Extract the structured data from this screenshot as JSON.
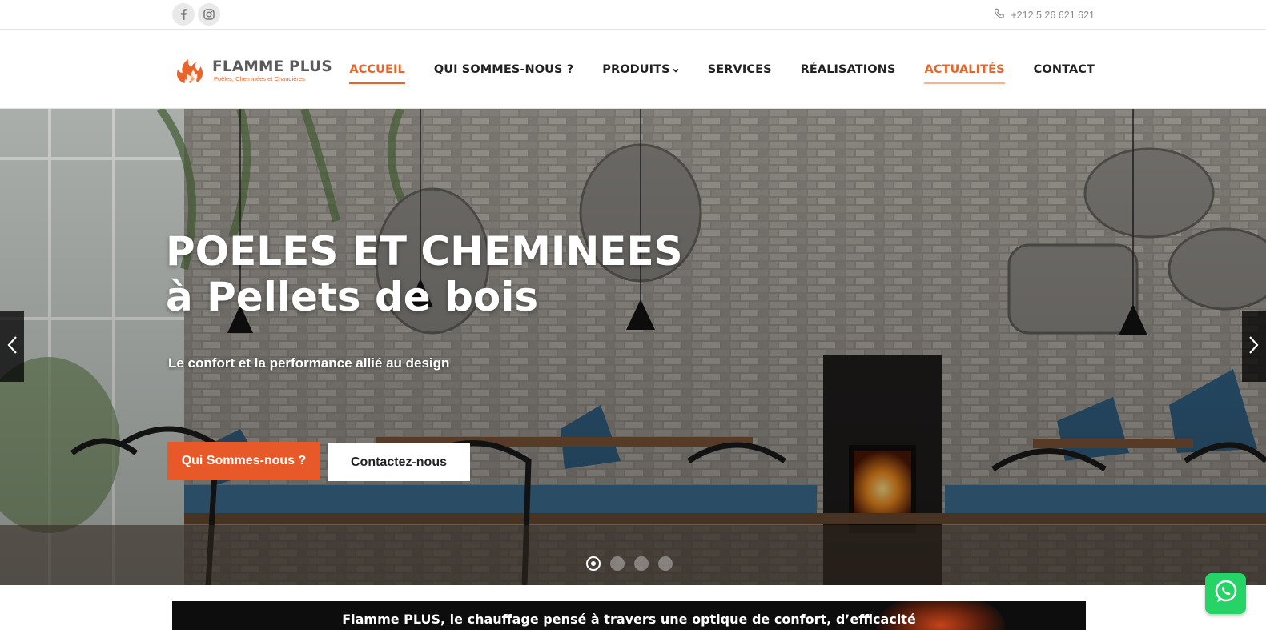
{
  "topbar": {
    "social_icons": [
      "facebook-icon",
      "instagram-icon"
    ],
    "phone_icon": "phone-icon",
    "phone": "+212 5 26 621 621"
  },
  "brand": {
    "name": "FLAMME PLUS",
    "tagline": "Poêles, Cheminées et Chaudières",
    "logo_icon": "flame-icon",
    "accent_color": "#e8642a"
  },
  "nav": {
    "items": [
      {
        "label": "ACCUEIL",
        "state": "active"
      },
      {
        "label": "QUI SOMMES-NOUS ?",
        "state": "normal"
      },
      {
        "label": "PRODUITS",
        "state": "normal",
        "icon": "chevron-down-icon"
      },
      {
        "label": "SERVICES",
        "state": "normal"
      },
      {
        "label": "RÉALISATIONS",
        "state": "normal"
      },
      {
        "label": "ACTUALITÉS",
        "state": "highlighted"
      },
      {
        "label": "CONTACT",
        "state": "normal"
      }
    ]
  },
  "hero": {
    "title_line1": "POELES ET CHEMINEES",
    "title_line2": "à Pellets de bois",
    "subtitle": "Le confort et la performance allié au design",
    "primary_button": "Qui Sommes-nous ?",
    "secondary_button": "Contactez-nous",
    "primary_color": "#e8592a",
    "slide_count": 4,
    "active_slide": 1,
    "prev_icon": "chevron-left-icon",
    "next_icon": "chevron-right-icon"
  },
  "banner": {
    "text": "Flamme PLUS, le chauffage pensé à travers une optique de confort, d’efficacité"
  },
  "whatsapp": {
    "icon": "whatsapp-icon",
    "color": "#25d366"
  }
}
